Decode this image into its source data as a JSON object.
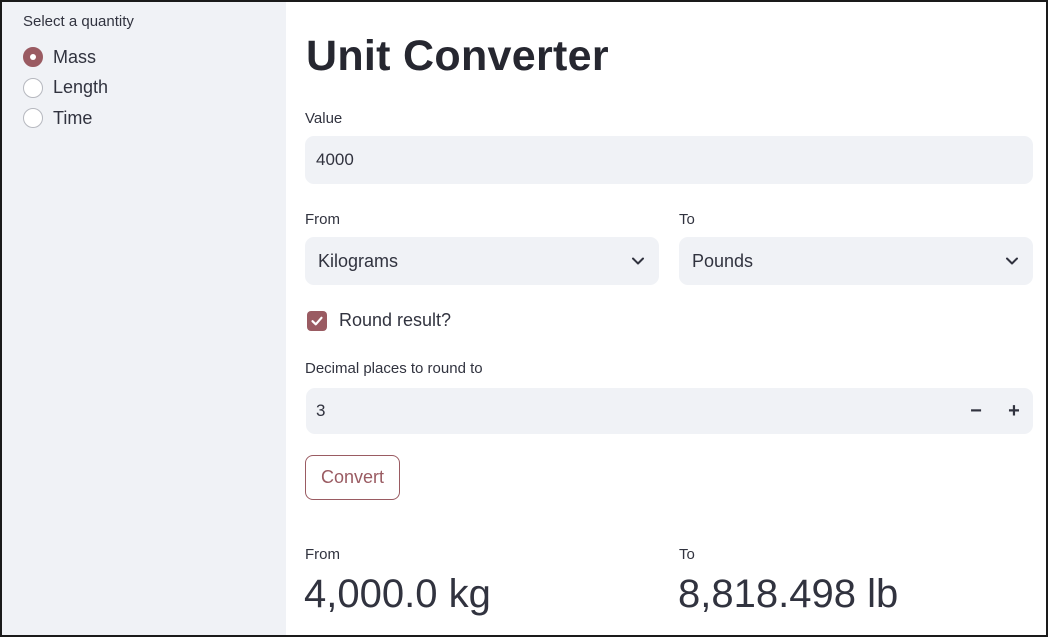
{
  "sidebar": {
    "title": "Select a quantity",
    "options": [
      {
        "label": "Mass",
        "selected": true
      },
      {
        "label": "Length",
        "selected": false
      },
      {
        "label": "Time",
        "selected": false
      }
    ]
  },
  "main": {
    "title": "Unit Converter",
    "value_label": "Value",
    "value": "4000",
    "from_label": "From",
    "from_value": "Kilograms",
    "to_label": "To",
    "to_value": "Pounds",
    "round_label": "Round result?",
    "round_checked": true,
    "decimals_label": "Decimal places to round to",
    "decimals_value": "3",
    "minus_symbol": "−",
    "plus_symbol": "+",
    "convert_label": "Convert",
    "result": {
      "from_label": "From",
      "from_value": "4,000.0 kg",
      "to_label": "To",
      "to_value": "8,818.498 lb"
    }
  },
  "colors": {
    "accent": "#9a5b62",
    "sidebar_bg": "#f0f2f6",
    "input_bg": "#f0f2f6",
    "text": "#31333f"
  },
  "icons": {
    "select_chevron": "chevron-down-icon",
    "checkbox_check": "check-icon"
  }
}
